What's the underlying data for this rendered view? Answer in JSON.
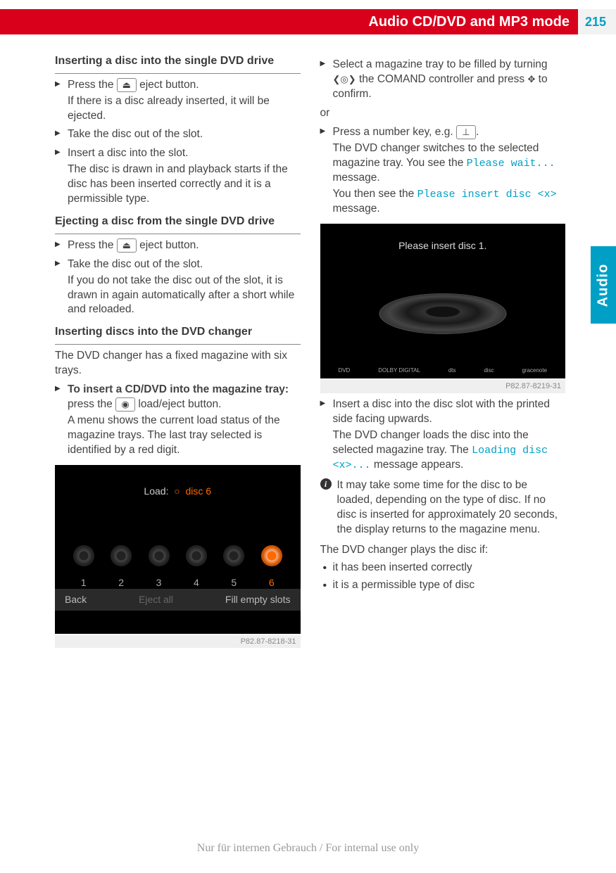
{
  "header": {
    "title": "Audio CD/DVD and MP3 mode",
    "page": "215",
    "sideTab": "Audio"
  },
  "icons": {
    "eject": "⏏",
    "loadEject": "◉",
    "numKey": "⊥",
    "turnLeft": "❮",
    "turnRight": "❯",
    "rotary": "◎",
    "press": "✥"
  },
  "left": {
    "sec1": {
      "title": "Inserting a disc into the single DVD drive",
      "s1a": "Press the ",
      "s1b": " eject button.",
      "s1sub": "If there is a disc already inserted, it will be ejected.",
      "s2": "Take the disc out of the slot.",
      "s3": "Insert a disc into the slot.",
      "s3sub": "The disc is drawn in and playback starts if the disc has been inserted correctly and it is a permissible type."
    },
    "sec2": {
      "title": "Ejecting a disc from the single DVD drive",
      "s1a": "Press the ",
      "s1b": " eject button.",
      "s2": "Take the disc out of the slot.",
      "s2sub": "If you do not take the disc out of the slot, it is drawn in again automatically after a short while and reloaded."
    },
    "sec3": {
      "title": "Inserting discs into the DVD changer",
      "intro": "The DVD changer has a fixed magazine with six trays.",
      "s1bold": "To insert a CD/DVD into the magazine tray:",
      "s1a": " press the ",
      "s1b": " load/eject button.",
      "s1sub": "A menu shows the current load status of the magazine trays. The last tray selected is identified by a red digit."
    }
  },
  "ss1": {
    "top1": "Load:",
    "top2": "disc 6",
    "slots": [
      "1",
      "2",
      "3",
      "4",
      "5",
      "6"
    ],
    "back": "Back",
    "ejectAll": "Eject all",
    "fill": "Fill empty slots",
    "id": "P82.87-8218-31"
  },
  "right": {
    "s1a": "Select a magazine tray to be filled by turning ",
    "s1b": " the COMAND controller and press ",
    "s1c": " to confirm.",
    "or": "or",
    "s2a": "Press a number key, e.g. ",
    "s2b": ".",
    "s2sub1": "The DVD changer switches to the selected magazine tray. You see the ",
    "s2msg1": "Please wait...",
    "s2sub1b": " message.",
    "s2sub2": "You then see the ",
    "s2msg2": "Please insert disc <x>",
    "s2sub2b": " message.",
    "s3": "Insert a disc into the disc slot with the printed side facing upwards.",
    "s3sub1": "The DVD changer loads the disc into the selected magazine tray. The ",
    "s3msg": "Loading disc <x>...",
    "s3sub1b": " message appears.",
    "info": "It may take some time for the disc to be loaded, depending on the type of disc. If no disc is inserted for approximately 20 seconds, the display returns to the magazine menu.",
    "plain": "The DVD changer plays the disc if:",
    "b1": "it has been inserted correctly",
    "b2": "it is a permissible type of disc"
  },
  "ss2": {
    "msg": "Please insert disc 1.",
    "logos": [
      "DVD",
      "DOLBY DIGITAL",
      "dts",
      "disc",
      "gracenote"
    ],
    "id": "P82.87-8219-31"
  },
  "footer": "Nur für internen Gebrauch / For internal use only"
}
